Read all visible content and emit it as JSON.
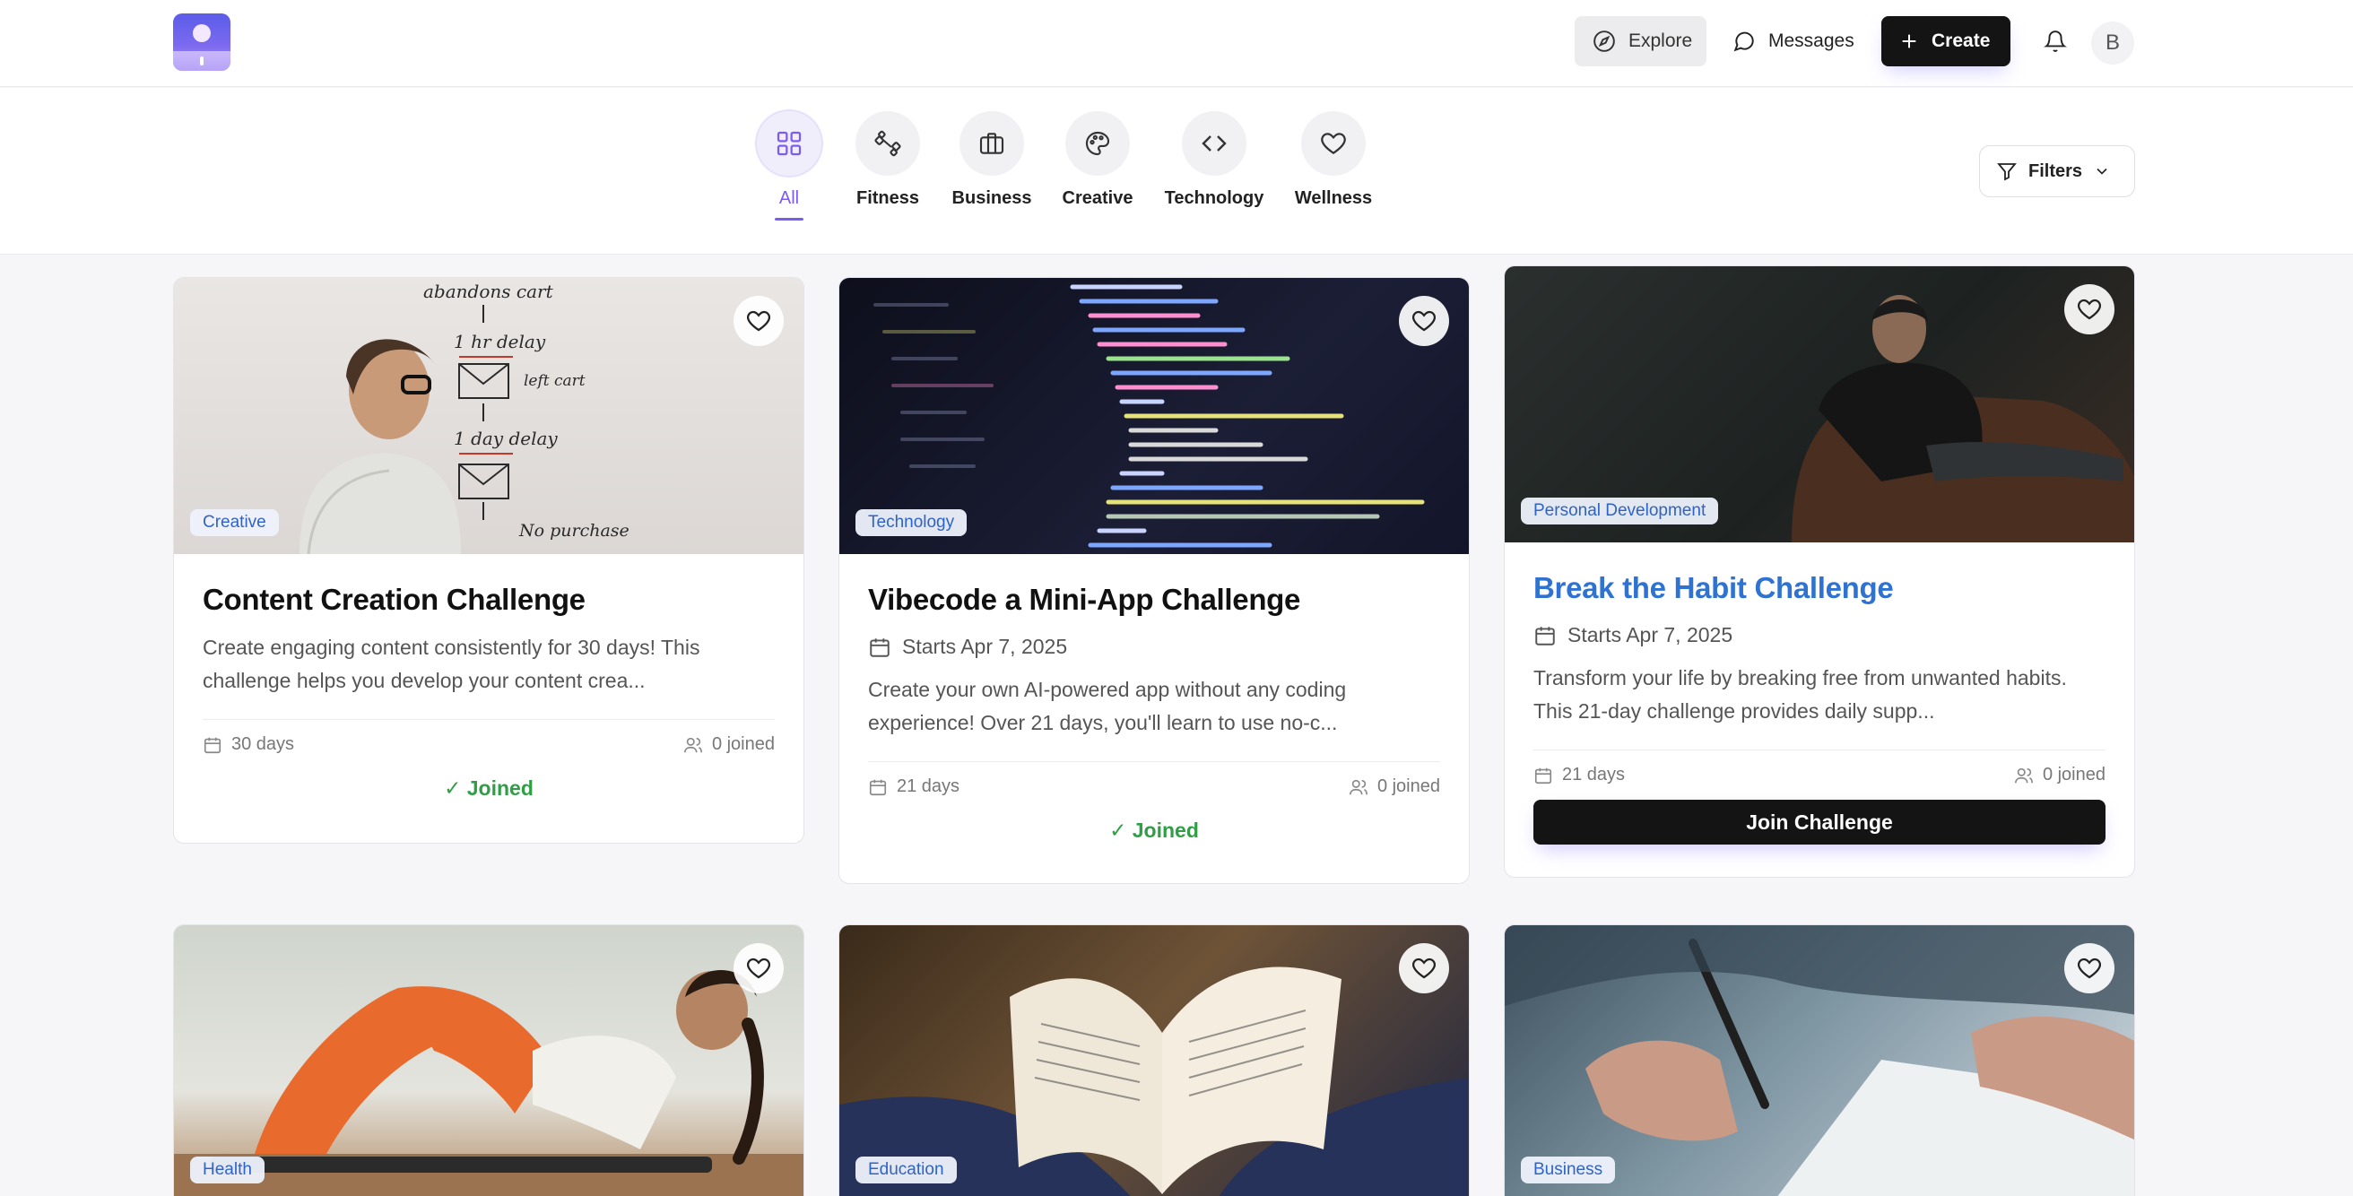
{
  "nav": {
    "explore_label": "Explore",
    "messages_label": "Messages",
    "create_label": "Create",
    "avatar_initial": "B"
  },
  "categories": [
    {
      "label": "All",
      "icon": "grid-icon",
      "active": true
    },
    {
      "label": "Fitness",
      "icon": "dumbbell-icon",
      "active": false
    },
    {
      "label": "Business",
      "icon": "briefcase-icon",
      "active": false
    },
    {
      "label": "Creative",
      "icon": "palette-icon",
      "active": false
    },
    {
      "label": "Technology",
      "icon": "code-icon",
      "active": false
    },
    {
      "label": "Wellness",
      "icon": "heart-icon",
      "active": false
    }
  ],
  "filters_label": "Filters",
  "cards": [
    {
      "badge": "Creative",
      "title": "Content Creation Challenge",
      "starts": "",
      "description": "Create engaging content consistently for 30 days! This challenge helps you develop your content crea...",
      "duration": "30 days",
      "joined_count": "0 joined",
      "status": "✓ Joined"
    },
    {
      "badge": "Technology",
      "title": "Vibecode a Mini-App Challenge",
      "starts": "Starts Apr 7, 2025",
      "description": "Create your own AI-powered app without any coding experience! Over 21 days, you'll learn to use no-c...",
      "duration": "21 days",
      "joined_count": "0 joined",
      "status": "✓ Joined"
    },
    {
      "badge": "Personal Development",
      "title": "Break the Habit Challenge",
      "starts": "Starts Apr 7, 2025",
      "description": "Transform your life by breaking free from unwanted habits. This 21-day challenge provides daily supp...",
      "duration": "21 days",
      "joined_count": "0 joined",
      "button_label": "Join Challenge"
    },
    {
      "badge": "Health"
    },
    {
      "badge": "Education"
    },
    {
      "badge": "Business"
    }
  ],
  "whiteboard_text": [
    "abandons cart",
    "1 hr delay",
    "left cart",
    "1 day delay",
    "No purchase"
  ],
  "colors": {
    "accent": "#7c5cf0",
    "joined_green": "#2f9e44",
    "link_blue": "#2e72d2",
    "badge_text": "#2f63c5"
  }
}
